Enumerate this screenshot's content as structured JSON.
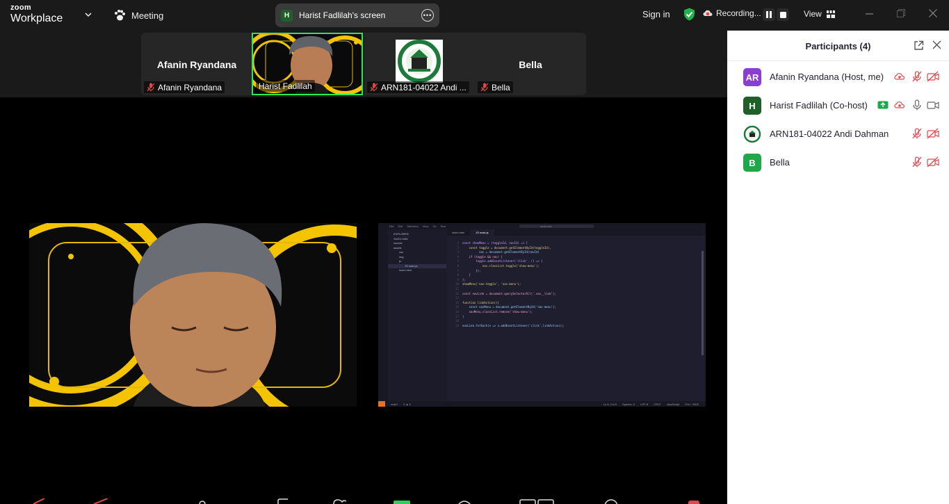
{
  "titlebar": {
    "brand_top": "zoom",
    "brand_bottom": "Workplace",
    "meeting_label": "Meeting",
    "screen_share_label": "Harist Fadlilah's screen",
    "screen_share_initial": "H",
    "signin_label": "Sign in",
    "recording_label": "Recording...",
    "view_label": "View"
  },
  "thumbnails": [
    {
      "display_name": "Afanin Ryandana",
      "label": "Afanin Ryandana",
      "muted": true
    },
    {
      "display_name": "",
      "label": "Harist Fadlilah",
      "muted": false,
      "active_speaker": true
    },
    {
      "display_name": "",
      "label": "ARN181-04022 Andi ...",
      "muted": true
    },
    {
      "display_name": "Bella",
      "label": "Bella",
      "muted": true
    }
  ],
  "editor": {
    "menu": [
      "File",
      "Edit",
      "Selection",
      "View",
      "Go",
      "Run"
    ],
    "search": "sudo-nav",
    "explorer_title": "EXPLORER",
    "tree": [
      "SUDO-NAV",
      "vscode",
      "assets",
      "css",
      "img",
      "js",
      "JS main.js",
      "index.html"
    ],
    "tabs": [
      "index.html",
      "JS main.js"
    ],
    "code": [
      "const showMenu = (toggleId, navId) => {",
      "    const toggle = document.getElementById(toggleId),",
      "          nav = document.getElementById(navId)",
      "    if (toggle && nav) {",
      "        toggle.addEventListener('click', () => {",
      "            nav.classList.toggle('show-menu');",
      "        });",
      "    }",
      "};",
      "showMenu('nav-toggle', 'nav-menu');",
      "",
      "const navLink = document.querySelectorAll('.nav__link');",
      "",
      "function linkAction(){",
      "    const navMenu = document.getElementById('nav-menu');",
      "    navMenu.classList.remove('show-menu');",
      "}",
      "",
      "navLink.forEach(n => n.addEventListener('click',linkAction));"
    ],
    "status": [
      "main*",
      "0 ▲ 0",
      "Ln 8, Col 6",
      "Spaces: 4",
      "UTF-8",
      "CRLF",
      "JavaScript",
      "Port : 5500"
    ]
  },
  "panel": {
    "title": "Participants (4)",
    "participants": [
      {
        "initials": "AR",
        "name": "Afanin Ryandana (Host, me)",
        "color": "#8a3fd1",
        "recording": true,
        "mic": "muted",
        "video": "off"
      },
      {
        "initials": "H",
        "name": "Harist Fadlilah (Co-host)",
        "color": "#1f5f2a",
        "share": true,
        "recording": true,
        "mic": "on",
        "video": "on"
      },
      {
        "initials": "",
        "name": "ARN181-04022 Andi Dahman",
        "color": "#ffffff",
        "mic": "muted",
        "video": "off"
      },
      {
        "initials": "B",
        "name": "Bella",
        "color": "#1fa84a",
        "mic": "muted",
        "video": "off"
      }
    ]
  },
  "colors": {
    "active_speaker": "#2de65a",
    "muted_red": "#e0474a",
    "recording_red": "#e0474a",
    "share_green": "#1fa84a"
  }
}
